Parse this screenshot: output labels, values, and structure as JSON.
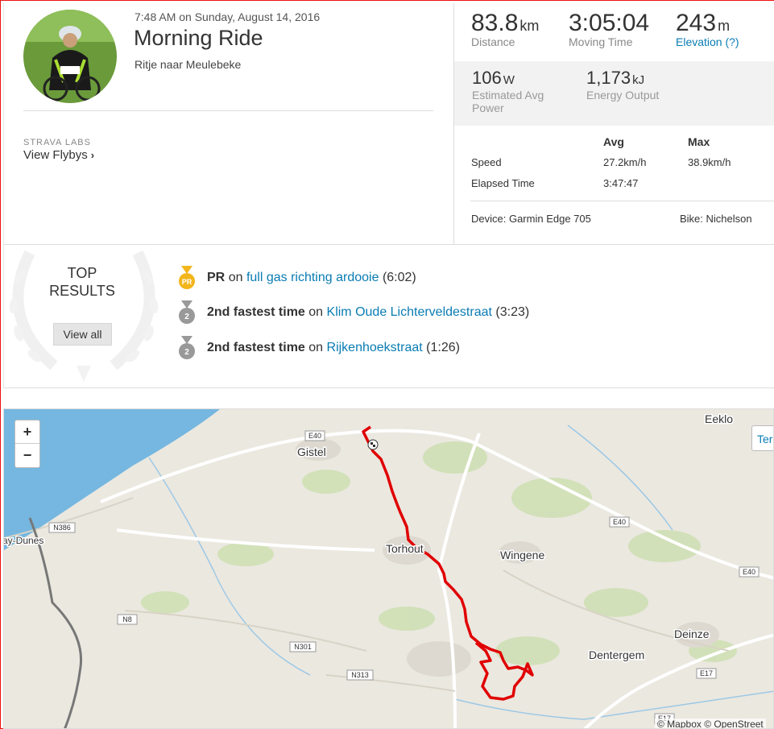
{
  "activity": {
    "datetime": "7:48 AM on Sunday, August 14, 2016",
    "title": "Morning Ride",
    "description": "Ritje naar Meulebeke"
  },
  "labs": {
    "label": "STRAVA LABS",
    "flybys": "View Flybys"
  },
  "stats": {
    "distance": {
      "value": "83.8",
      "unit": "km",
      "label": "Distance"
    },
    "moving_time": {
      "value": "3:05:04",
      "label": "Moving Time"
    },
    "elevation": {
      "value": "243",
      "unit": "m",
      "label": "Elevation (?)"
    },
    "power": {
      "value": "106",
      "unit": "W",
      "label_line1": "Estimated Avg",
      "label_line2": "Power"
    },
    "energy": {
      "value": "1,173",
      "unit": "kJ",
      "label": "Energy Output"
    }
  },
  "table": {
    "headers": [
      "Avg",
      "Max"
    ],
    "rows": [
      {
        "label": "Speed",
        "avg": "27.2km/h",
        "max": "38.9km/h"
      },
      {
        "label": "Elapsed Time",
        "avg": "3:47:47",
        "max": ""
      }
    ]
  },
  "gear": {
    "device": "Device: Garmin Edge 705",
    "bike": "Bike: Nichelson"
  },
  "top_results": {
    "title_line1": "TOP",
    "title_line2": "RESULTS",
    "view_all": "View all",
    "efforts": [
      {
        "medal": "PR",
        "achievement": "PR",
        "on": "on",
        "segment": "full gas richting ardooie",
        "time": "(6:02)"
      },
      {
        "medal": "2",
        "achievement": "2nd fastest time",
        "on": "on",
        "segment": "Klim Oude Lichterveldestraat",
        "time": "(3:23)"
      },
      {
        "medal": "2",
        "achievement": "2nd fastest time",
        "on": "on",
        "segment": "Rijkenhoekstraat",
        "time": "(1:26)"
      }
    ]
  },
  "map": {
    "zoom_in": "+",
    "zoom_out": "−",
    "terrain": "Ter",
    "attribution": "© Mapbox © OpenStreet",
    "places": [
      "Gistel",
      "Torhout",
      "Wingene",
      "Eeklo",
      "Deinze",
      "Dentergem",
      "ay-Dunes"
    ],
    "roads": [
      "E40",
      "E40",
      "E40",
      "N386",
      "N8",
      "N301",
      "N313",
      "E17",
      "E17"
    ],
    "colors": {
      "sea": "#75b7e0",
      "land": "#ebe8e0",
      "route": "#e00000"
    }
  }
}
